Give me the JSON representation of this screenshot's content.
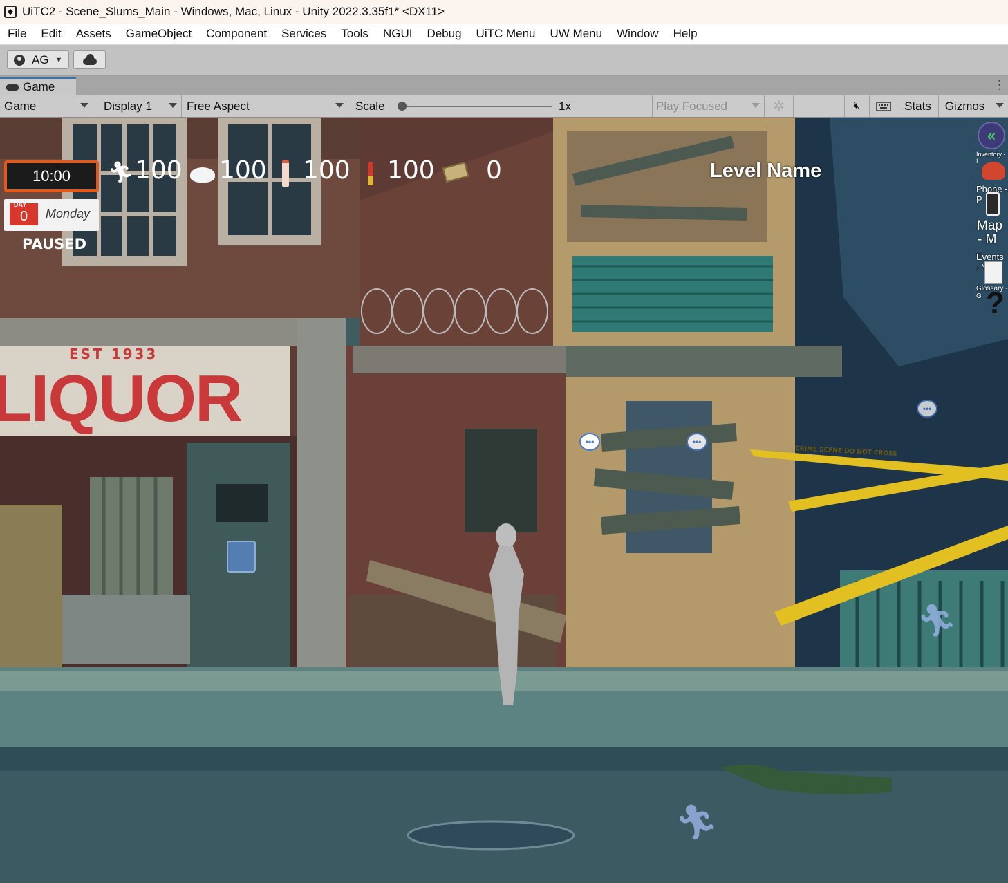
{
  "window": {
    "title": "UiTC2 - Scene_Slums_Main - Windows, Mac, Linux - Unity 2022.3.35f1* <DX11>"
  },
  "menubar": {
    "items": [
      "File",
      "Edit",
      "Assets",
      "GameObject",
      "Component",
      "Services",
      "Tools",
      "NGUI",
      "Debug",
      "UiTC Menu",
      "UW Menu",
      "Window",
      "Help"
    ]
  },
  "toolbar": {
    "account_label": "AG"
  },
  "tab": {
    "label": "Game"
  },
  "game_controls": {
    "mode": "Game",
    "display": "Display 1",
    "aspect": "Free Aspect",
    "scale_label": "Scale",
    "scale_value": "1x",
    "play_mode": "Play Focused",
    "stats": "Stats",
    "gizmos": "Gizmos"
  },
  "hud": {
    "time": "10:00",
    "day_label": "DAY",
    "day_number": "0",
    "weekday": "Monday",
    "status": "PAUSED",
    "stats": [
      {
        "icon": "running-icon",
        "value": "100"
      },
      {
        "icon": "food-icon",
        "value": "100"
      },
      {
        "icon": "drink-icon",
        "value": "100"
      },
      {
        "icon": "lipstick-icon",
        "value": "100"
      },
      {
        "icon": "money-icon",
        "value": "0"
      }
    ],
    "level_name": "Level Name"
  },
  "side_menu": {
    "inventory": "Inventory - I",
    "phone": "Phone - P",
    "map": "Map",
    "map_key": "- M",
    "events": "Events - Y",
    "glossary": "Glossary - G"
  },
  "scene": {
    "sign_est": "EST 1933",
    "sign_main": "LIQUOR",
    "tape_text": "CRIME SCENE  DO NOT CROSS"
  },
  "colors": {
    "accent_orange": "#e15a1d",
    "calendar_red": "#d8382c",
    "tab_highlight": "#3a72b0",
    "sign_red": "#c9393a"
  }
}
